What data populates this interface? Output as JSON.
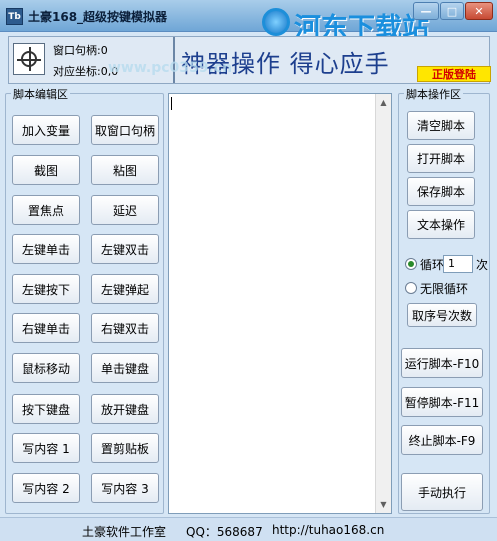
{
  "window": {
    "icon_text": "Tb",
    "title": "土豪168_超级按键模拟器",
    "minimize": "—",
    "maximize": "□",
    "close": "✕"
  },
  "watermark": {
    "text": "河东下载站",
    "url": "www.pc0359.cn"
  },
  "header": {
    "handle_label": "窗口句柄:0",
    "coord_label": "对应坐标:0,0",
    "slogan": "神器操作  得心应手",
    "register": "正版登陆"
  },
  "left_panel": {
    "title": "脚本编辑区",
    "buttons": [
      "加入变量",
      "取窗口句柄",
      "截图",
      "粘图",
      "置焦点",
      "延迟",
      "左键单击",
      "左键双击",
      "左键按下",
      "左键弹起",
      "右键单击",
      "右键双击",
      "鼠标移动",
      "单击键盘",
      "按下键盘",
      "放开键盘",
      "写内容 1",
      "置剪贴板",
      "写内容 2",
      "写内容 3"
    ]
  },
  "editor": {
    "content": "",
    "scroll_up": "▲",
    "scroll_down": "▼"
  },
  "right_panel": {
    "title": "脚本操作区",
    "clear": "清空脚本",
    "open": "打开脚本",
    "save": "保存脚本",
    "text_ops": "文本操作",
    "loop_label": "循环",
    "loop_count": "1",
    "loop_unit": "次",
    "infinite_label": "无限循环",
    "seq_count": "取序号次数",
    "run": "运行脚本-F10",
    "pause": "暂停脚本-F11",
    "stop": "终止脚本-F9",
    "manual": "手动执行",
    "loop_selected": "循环"
  },
  "statusbar": {
    "studio": "土豪软件工作室",
    "qq": "QQ：568687",
    "url": "http://tuhao168.cn"
  },
  "colors": {
    "window_bg": "#d6e6f5",
    "slogan": "#1d3f8e",
    "register_bg": "#ffe600",
    "register_text": "#d40000",
    "watermark": "#1a8fde"
  }
}
